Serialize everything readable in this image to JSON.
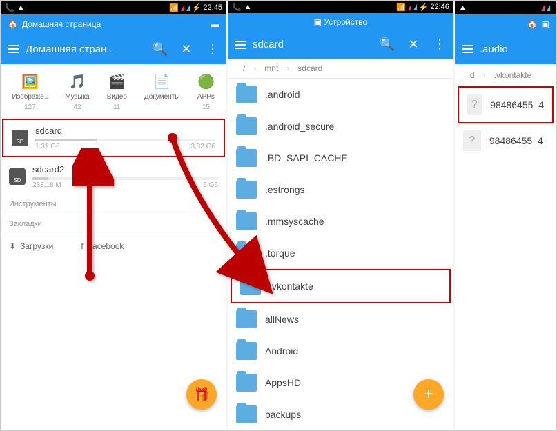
{
  "panels": [
    {
      "statusTime": "22:45",
      "tabLabel": "Домашняя страница",
      "title": "Домашняя стран..",
      "categories": [
        {
          "icon": "🖼️",
          "label": "Изображе..",
          "count": "127",
          "color": "#4FC3F7"
        },
        {
          "icon": "🎵",
          "label": "Музыка",
          "count": "42",
          "color": "#FF9800"
        },
        {
          "icon": "🎬",
          "label": "Видео",
          "count": "11",
          "color": "#2196F3"
        },
        {
          "icon": "📄",
          "label": "Документы",
          "count": "",
          "color": "#FFB74D"
        },
        {
          "icon": "🟢",
          "label": "APPs",
          "count": "15",
          "color": "#4CAF50"
        }
      ],
      "storage": [
        {
          "name": "sdcard",
          "used": "1,31 G6",
          "total": "3,82 G6",
          "fill": 34,
          "highlighted": true
        },
        {
          "name": "sdcard2",
          "used": "283,18 M",
          "total": "6 G6",
          "fill": 8,
          "highlighted": false
        }
      ],
      "sectionTools": "Инструменты",
      "sectionBookmarks": "Закладки",
      "bookmarks": [
        {
          "icon": "⬇",
          "label": "Загрузки"
        },
        {
          "icon": "f",
          "label": "Facebook"
        }
      ],
      "fabIcon": "🎁"
    },
    {
      "statusTime": "22:46",
      "tabLabel": "Устройство",
      "title": "sdcard",
      "breadcrumb": [
        "/",
        "mnt",
        "sdcard"
      ],
      "folders": [
        {
          "name": ".android",
          "highlighted": false
        },
        {
          "name": ".android_secure",
          "highlighted": false
        },
        {
          "name": ".BD_SAPI_CACHE",
          "highlighted": false
        },
        {
          "name": ".estrongs",
          "highlighted": false
        },
        {
          "name": ".mmsyscache",
          "highlighted": false
        },
        {
          "name": ".torque",
          "highlighted": false
        },
        {
          "name": ".vkontakte",
          "highlighted": true
        },
        {
          "name": "allNews",
          "highlighted": false
        },
        {
          "name": "Android",
          "highlighted": false
        },
        {
          "name": "AppsHD",
          "highlighted": false
        },
        {
          "name": "backups",
          "highlighted": false
        }
      ],
      "fabIcon": "+"
    },
    {
      "statusTime": "",
      "tabLabel": "",
      "title": ".audio",
      "breadcrumb": [
        "d",
        ".vkontakte"
      ],
      "files": [
        {
          "name": "98486455_4",
          "highlighted": true
        },
        {
          "name": "98486455_4",
          "highlighted": false
        }
      ]
    }
  ]
}
